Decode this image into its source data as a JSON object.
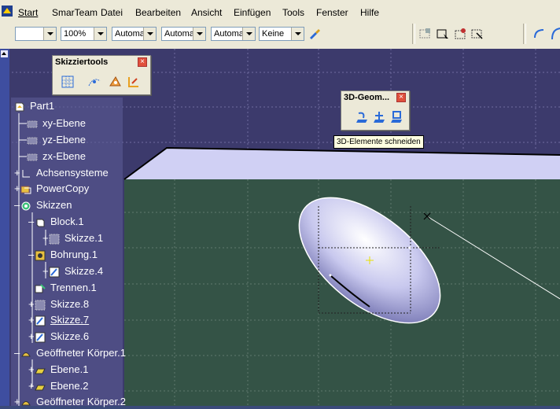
{
  "menu": {
    "items": [
      {
        "label": "Start",
        "active": true
      },
      {
        "label": "SmarTeam"
      },
      {
        "label": "Datei"
      },
      {
        "label": "Bearbeiten"
      },
      {
        "label": "Ansicht"
      },
      {
        "label": "Einfügen"
      },
      {
        "label": "Tools"
      },
      {
        "label": "Fenster"
      },
      {
        "label": "Hilfe"
      }
    ]
  },
  "toolbar": {
    "linetype_value": "",
    "zoom_value": "100%",
    "auto1_value": "Automa",
    "auto2_value": "Automa",
    "auto3_value": "Automa",
    "keine_value": "Keine"
  },
  "panels": {
    "skizziertools": {
      "title": "Skizziertools"
    },
    "geom3d": {
      "title": "3D-Geom..."
    }
  },
  "tooltip": {
    "text": "3D-Elemente schneiden"
  },
  "tree": {
    "nodes": [
      {
        "label": "Part1"
      },
      {
        "label": "xy-Ebene"
      },
      {
        "label": "yz-Ebene"
      },
      {
        "label": "zx-Ebene"
      },
      {
        "label": "Achsensysteme"
      },
      {
        "label": "PowerCopy"
      },
      {
        "label": "Skizzen"
      },
      {
        "label": "Block.1"
      },
      {
        "label": "Skizze.1"
      },
      {
        "label": "Bohrung.1"
      },
      {
        "label": "Skizze.4"
      },
      {
        "label": "Trennen.1"
      },
      {
        "label": "Skizze.8"
      },
      {
        "label": "Skizze.7",
        "underline": true
      },
      {
        "label": "Skizze.6"
      },
      {
        "label": "Geöffneter Körper.1"
      },
      {
        "label": "Ebene.1"
      },
      {
        "label": "Ebene.2"
      },
      {
        "label": "Geöffneter Körper.2"
      }
    ]
  },
  "colors": {
    "background": "#3c3a6c",
    "ground": "#345346",
    "plane": "#d0d0f4",
    "tree_text": "#ffffff"
  }
}
